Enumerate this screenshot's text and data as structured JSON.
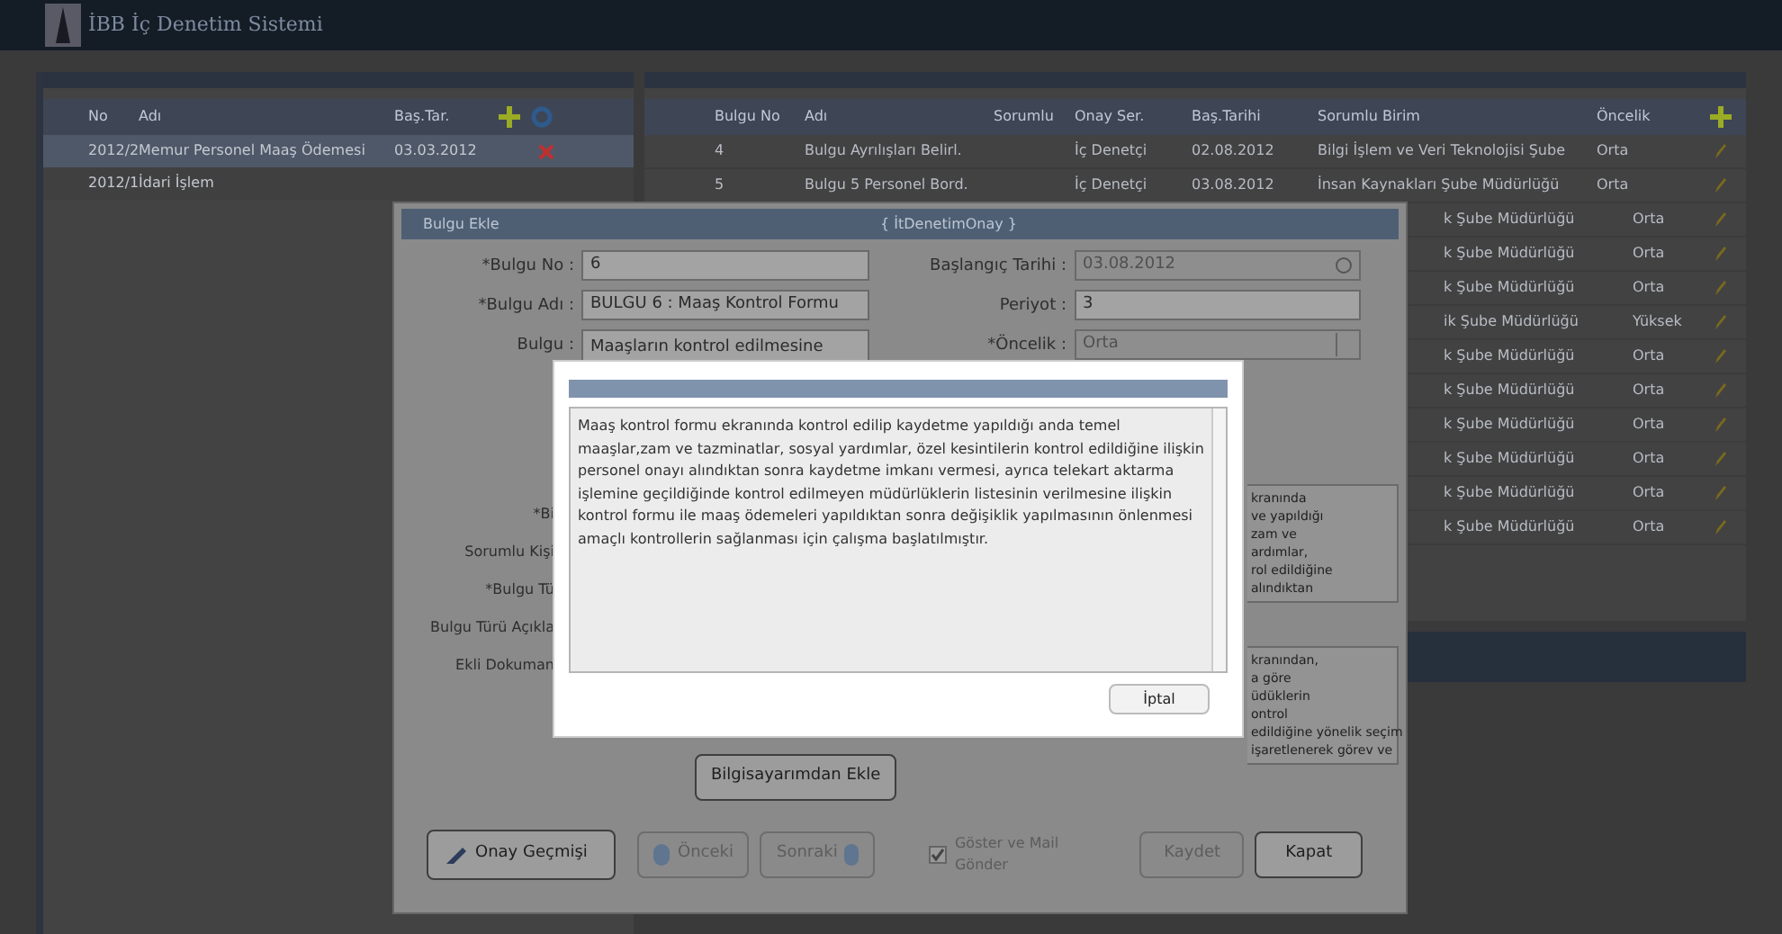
{
  "app": {
    "title": "İBB İç Denetim Sistemi"
  },
  "left_table": {
    "columns": [
      "No",
      "Adı",
      "Baş.Tar."
    ],
    "rows": [
      {
        "cells": [
          "2012/2",
          "Memur Personel Maaş Ödemesi",
          "03.03.2012"
        ],
        "selected": true
      },
      {
        "cells": [
          "2012/1",
          "İdari İşlem"
        ],
        "selected": false
      }
    ]
  },
  "right_table": {
    "columns": [
      "Bulgu No",
      "Adı",
      "Sorumlu",
      "Onay Ser.",
      "Baş.Tarihi",
      "Sorumlu Birim",
      "Öncelik"
    ],
    "rows": [
      {
        "kind": "full",
        "cells": [
          "4",
          "Bulgu Ayrılışları Belirl.",
          "",
          "İç Denetçi",
          "02.08.2012",
          "Bilgi İşlem ve Veri Teknolojisi Şube",
          "Orta"
        ]
      },
      {
        "kind": "full",
        "cells": [
          "5",
          "Bulgu 5 Personel Bord.",
          "",
          "İç Denetçi",
          "03.08.2012",
          "İnsan Kaynakları Şube Müdürlüğü",
          "Orta"
        ]
      },
      {
        "kind": "covered",
        "cells": [
          "k Şube Müdürlüğü",
          "Orta"
        ]
      },
      {
        "kind": "covered",
        "cells": [
          "k Şube Müdürlüğü",
          "Orta"
        ]
      },
      {
        "kind": "covered",
        "cells": [
          "k Şube Müdürlüğü",
          "Orta"
        ]
      },
      {
        "kind": "covered",
        "cells": [
          "ik Şube Müdürlüğü",
          "Yüksek"
        ]
      },
      {
        "kind": "covered",
        "cells": [
          "k Şube Müdürlüğü",
          "Orta"
        ]
      },
      {
        "kind": "covered",
        "cells": [
          "k Şube Müdürlüğü",
          "Orta"
        ]
      },
      {
        "kind": "covered",
        "cells": [
          "k Şube Müdürlüğü",
          "Orta"
        ]
      },
      {
        "kind": "covered",
        "cells": [
          "k Şube Müdürlüğü",
          "Orta"
        ]
      },
      {
        "kind": "covered",
        "cells": [
          "k Şube Müdürlüğü",
          "Orta"
        ]
      },
      {
        "kind": "covered",
        "cells": [
          "k Şube Müdürlüğü",
          "Orta"
        ]
      }
    ]
  },
  "dialog": {
    "title": "Bulgu Ekle",
    "tag": "{ İtDenetimOnay }",
    "fields": [
      {
        "label": "*Bulgu No :",
        "value": "6",
        "disabled": false,
        "kind": "text"
      },
      {
        "label": "Başlangıç Tarihi :",
        "value": "03.08.2012",
        "disabled": true,
        "kind": "date"
      },
      {
        "label": "*Bulgu Adı :",
        "value": "BULGU 6 : Maaş Kontrol Formu",
        "disabled": false,
        "kind": "text"
      },
      {
        "label": "Periyot :",
        "value": "3",
        "disabled": false,
        "kind": "text"
      },
      {
        "label": "Bulgu :",
        "value": "Maaşların kontrol edilmesine",
        "disabled": false,
        "kind": "textarea"
      },
      {
        "label": "*Öncelik :",
        "value": "Orta",
        "disabled": true,
        "kind": "select"
      }
    ],
    "covered_labels": [
      "*Bi",
      "Sorumlu Kişi",
      "*Bulgu Tü",
      "Bulgu Türü Açıkla",
      "Ekli Dokuman"
    ],
    "covered_texts": [
      [
        "kranında",
        "ve yapıldığı",
        "zam ve",
        "ardımlar,",
        "rol edildiğine",
        "alındıktan"
      ],
      [
        "kranından,",
        "a göre",
        "üdüklerin",
        "ontrol",
        "edildiğine yönelik seçim",
        "işaretlenerek görev ve"
      ]
    ],
    "upload_button": "Bilgisayarımdan Ekle",
    "history_button": "Onay Geçmişi",
    "prev_button": {
      "label": "Önceki",
      "disabled": true
    },
    "next_button": {
      "label": "Sonraki",
      "disabled": true
    },
    "mail_checkbox": {
      "label": "Göster ve Mail Gönder",
      "checked": true,
      "disabled": true
    },
    "save_button": {
      "label": "Kaydet",
      "disabled": true
    },
    "close_button": {
      "label": "Kapat",
      "disabled": false
    }
  },
  "modal": {
    "text": "Maaş kontrol formu ekranında kontrol edilip kaydetme yapıldığı anda temel maaşlar,zam ve tazminatlar, sosyal yardımlar, özel kesintilerin kontrol edildiğine ilişkin personel onayı alındıktan sonra kaydetme imkanı vermesi, ayrıca telekart aktarma işlemine geçildiğinde kontrol edilmeyen müdürlüklerin listesinin verilmesine ilişkin kontrol formu ile maaş ödemeleri yapıldıktan sonra değişiklik yapılmasının önlenmesi amaçlı kontrollerin sağlanması için çalışma başlatılmıştır.",
    "cancel_button": "İptal"
  }
}
